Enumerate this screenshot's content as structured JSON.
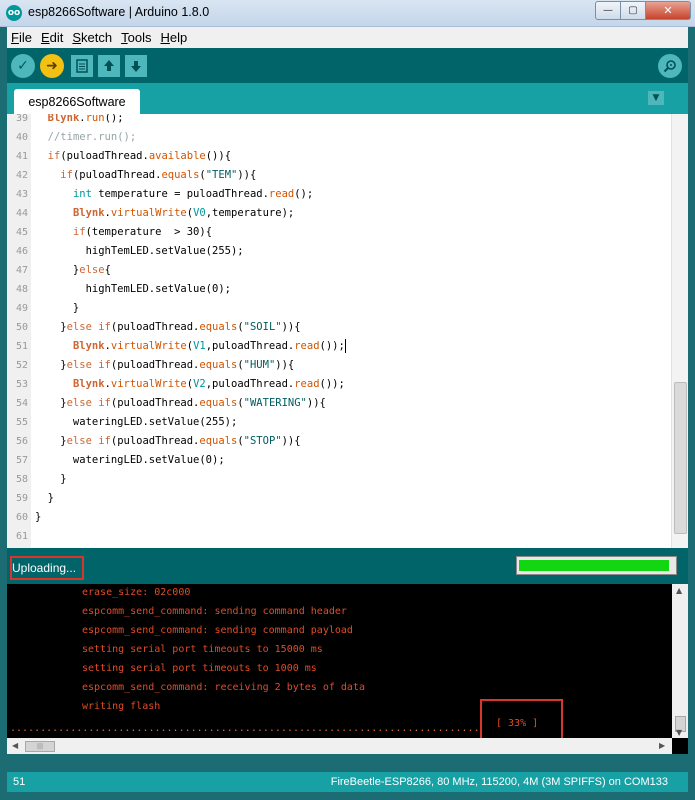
{
  "window": {
    "title": "esp8266Software | Arduino 1.8.0",
    "logo_text": "oo",
    "buttons": {
      "minimize": "—",
      "maximize": "▢",
      "close": "✕"
    }
  },
  "menu": [
    {
      "label": "File",
      "u": "F",
      "rest": "ile"
    },
    {
      "label": "Edit",
      "u": "E",
      "rest": "dit"
    },
    {
      "label": "Sketch",
      "u": "S",
      "rest": "ketch"
    },
    {
      "label": "Tools",
      "u": "T",
      "rest": "ools"
    },
    {
      "label": "Help",
      "u": "H",
      "rest": "elp"
    }
  ],
  "toolbar": {
    "verify_icon": "checkmark-icon",
    "upload_icon": "arrow-right-icon",
    "new_icon": "new-file-icon",
    "open_icon": "open-arrow-icon",
    "save_icon": "save-arrow-icon",
    "monitor_icon": "serial-monitor-icon"
  },
  "tab": {
    "label": "esp8266Software"
  },
  "editor": {
    "lines": [
      {
        "n": "39",
        "html": "  <span class='cls'>Blynk</span>.<span class='fn'>run</span>();"
      },
      {
        "n": "40",
        "html": "  //timer.run();"
      },
      {
        "n": "41",
        "html": "  <span class='kw'>if</span>(puloadThread.<span class='fn'>available</span>()){"
      },
      {
        "n": "42",
        "html": "    <span class='kw'>if</span>(puloadThread.<span class='fn'>equals</span>(<span class='str'>\"TEM\"</span>)){"
      },
      {
        "n": "43",
        "html": "      <span class='ty'>int</span> temperature = puloadThread.<span class='fn'>read</span>();"
      },
      {
        "n": "44",
        "html": "      <span class='cls'>Blynk</span>.<span class='fn'>virtualWrite</span>(<span class='ty'>V0</span>,temperature);"
      },
      {
        "n": "45",
        "html": "      <span class='kw'>if</span>(temperature  > 30){"
      },
      {
        "n": "46",
        "html": "        highTemLED.setValue(255);"
      },
      {
        "n": "47",
        "html": "      }<span class='kw'>else</span>{"
      },
      {
        "n": "48",
        "html": "        highTemLED.setValue(0);"
      },
      {
        "n": "49",
        "html": "      }"
      },
      {
        "n": "50",
        "html": "    }<span class='kw'>else if</span>(puloadThread.<span class='fn'>equals</span>(<span class='str'>\"SOIL\"</span>)){"
      },
      {
        "n": "51",
        "html": "      <span class='cls'>Blynk</span>.<span class='fn'>virtualWrite</span>(<span class='ty'>V1</span>,puloadThread.<span class='fn'>read</span>());<span class='cursor'></span>"
      },
      {
        "n": "52",
        "html": "    }<span class='kw'>else if</span>(puloadThread.<span class='fn'>equals</span>(<span class='str'>\"HUM\"</span>)){"
      },
      {
        "n": "53",
        "html": "      <span class='cls'>Blynk</span>.<span class='fn'>virtualWrite</span>(<span class='ty'>V2</span>,puloadThread.<span class='fn'>read</span>());"
      },
      {
        "n": "54",
        "html": "    }<span class='kw'>else if</span>(puloadThread.<span class='fn'>equals</span>(<span class='str'>\"WATERING\"</span>)){"
      },
      {
        "n": "55",
        "html": "      wateringLED.setValue(255);"
      },
      {
        "n": "56",
        "html": "    }<span class='kw'>else if</span>(puloadThread.<span class='fn'>equals</span>(<span class='str'>\"STOP\"</span>)){"
      },
      {
        "n": "57",
        "html": "      wateringLED.setValue(0);"
      },
      {
        "n": "58",
        "html": "    }"
      },
      {
        "n": "59",
        "html": "  }"
      },
      {
        "n": "60",
        "html": "}"
      },
      {
        "n": "61",
        "html": ""
      }
    ]
  },
  "status": {
    "text": "Uploading...",
    "progress_fraction": 0.97
  },
  "console": {
    "lines": [
      "erase_size: 02c000",
      "espcomm_send_command: sending command header",
      "espcomm_send_command: sending command payload",
      "setting serial port timeouts to 15000 ms",
      "setting serial port timeouts to 1000 ms",
      "espcomm_send_command: receiving 2 bytes of data",
      "writing flash"
    ],
    "dots_row1": "..............................................................................",
    "dots_row2": "...........",
    "percent": "[ 33% ]"
  },
  "bottom_bar": {
    "line_number": "51",
    "board": "FireBeetle-ESP8266, 80 MHz, 115200, 4M (3M SPIFFS) on COM133"
  },
  "colors": {
    "teal_dark": "#006468",
    "teal": "#17a1a5",
    "upload_yellow": "#f2c114",
    "highlight_red": "#d9352b",
    "progress_green": "#11d611"
  }
}
